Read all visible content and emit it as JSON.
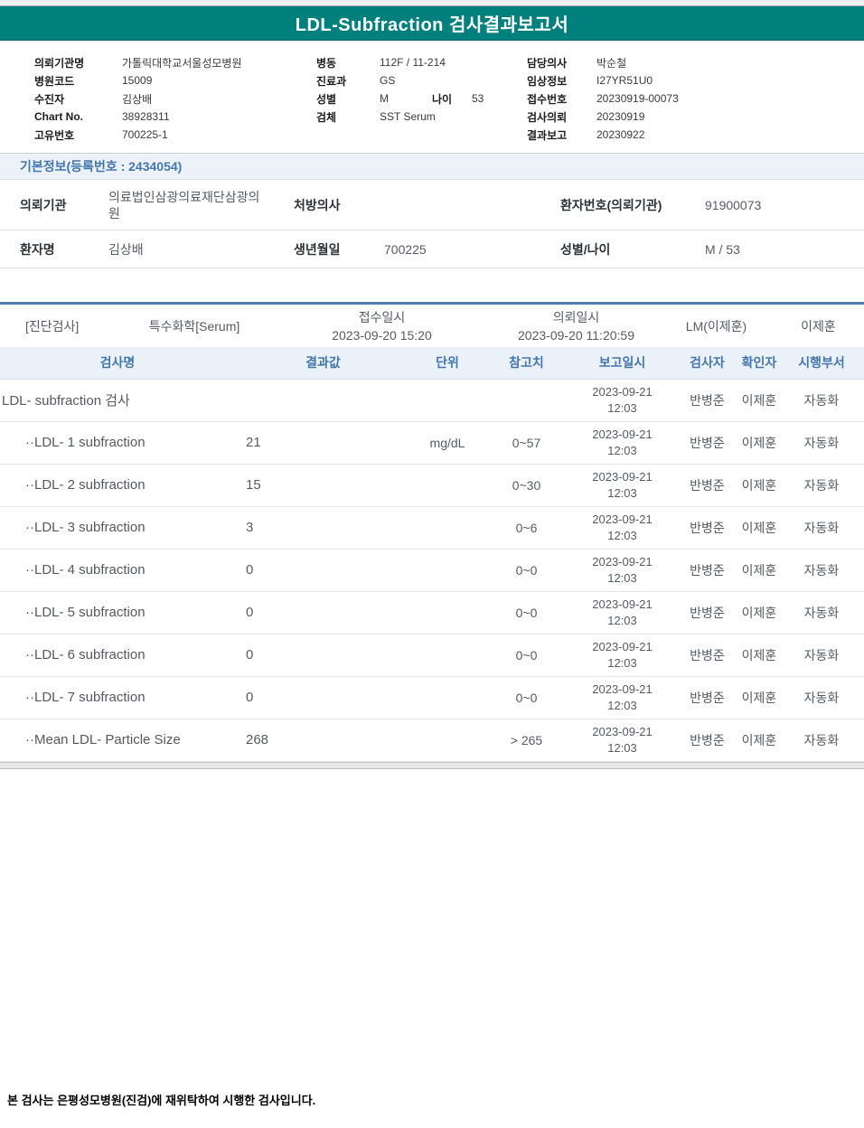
{
  "title": "LDL-Subfraction 검사결과보고서",
  "header_info": {
    "left": [
      {
        "label": "의뢰기관명",
        "value": "가톨릭대학교서울성모병원"
      },
      {
        "label": "병원코드",
        "value": "15009"
      },
      {
        "label": "수진자",
        "value": "김상배"
      },
      {
        "label": "Chart No.",
        "value": "38928311"
      },
      {
        "label": "고유번호",
        "value": "700225-1"
      }
    ],
    "middle": [
      {
        "label": "병동",
        "value": "112F / 11-214"
      },
      {
        "label": "진료과",
        "value": "GS"
      },
      {
        "label": "성별",
        "value": "M",
        "label2": "나이",
        "value2": "53"
      },
      {
        "label": "검체",
        "value": "SST Serum"
      }
    ],
    "right": [
      {
        "label": "담당의사",
        "value": "박순철"
      },
      {
        "label": "임상정보",
        "value": "I27YR51U0"
      },
      {
        "label": "접수번호",
        "value": "20230919-00073"
      },
      {
        "label": "검사의뢰",
        "value": "20230919"
      },
      {
        "label": "결과보고",
        "value": "20230922"
      }
    ]
  },
  "basic_info": {
    "section_title": "기본정보(등록번호 : 2434054)",
    "row1": {
      "label1": "의뢰기관",
      "value1": "의료법인삼광의료재단삼광의원",
      "label2": "처방의사",
      "value2": "",
      "label3": "환자번호(의뢰기관)",
      "value3": "91900073"
    },
    "row2": {
      "label1": "환자명",
      "value1": "김상배",
      "label2": "생년월일",
      "value2": "700225",
      "label3": "성별/나이",
      "value3": "M / 53"
    }
  },
  "section_row": {
    "dept": "[진단검사]",
    "category": "특수화학[Serum]",
    "receipt_label": "접수일시",
    "receipt_value": "2023-09-20 15:20",
    "request_label": "의뢰일시",
    "request_value": "2023-09-20 11:20:59",
    "lm": "LM(이제훈)",
    "confirmer": "이제훈"
  },
  "results": {
    "headers": {
      "name": "검사명",
      "result": "결과값",
      "unit": "단위",
      "ref": "참고치",
      "report_datetime": "보고일시",
      "tester": "검사자",
      "confirmer": "확인자",
      "dept": "시행부서"
    },
    "rows": [
      {
        "name": "LDL- subfraction 검사",
        "result": "",
        "unit": "",
        "ref": "",
        "date": "2023-09-21",
        "time": "12:03",
        "tester": "반병준",
        "confirmer": "이제훈",
        "dept": "자동화"
      },
      {
        "name": "··LDL- 1 subfraction",
        "result": "21",
        "unit": "mg/dL",
        "ref": "0~57",
        "date": "2023-09-21",
        "time": "12:03",
        "tester": "반병준",
        "confirmer": "이제훈",
        "dept": "자동화"
      },
      {
        "name": "··LDL- 2 subfraction",
        "result": "15",
        "unit": "",
        "ref": "0~30",
        "date": "2023-09-21",
        "time": "12:03",
        "tester": "반병준",
        "confirmer": "이제훈",
        "dept": "자동화"
      },
      {
        "name": "··LDL- 3 subfraction",
        "result": "3",
        "unit": "",
        "ref": "0~6",
        "date": "2023-09-21",
        "time": "12:03",
        "tester": "반병준",
        "confirmer": "이제훈",
        "dept": "자동화"
      },
      {
        "name": "··LDL- 4 subfraction",
        "result": "0",
        "unit": "",
        "ref": "0~0",
        "date": "2023-09-21",
        "time": "12:03",
        "tester": "반병준",
        "confirmer": "이제훈",
        "dept": "자동화"
      },
      {
        "name": "··LDL- 5 subfraction",
        "result": "0",
        "unit": "",
        "ref": "0~0",
        "date": "2023-09-21",
        "time": "12:03",
        "tester": "반병준",
        "confirmer": "이제훈",
        "dept": "자동화"
      },
      {
        "name": "··LDL- 6 subfraction",
        "result": "0",
        "unit": "",
        "ref": "0~0",
        "date": "2023-09-21",
        "time": "12:03",
        "tester": "반병준",
        "confirmer": "이제훈",
        "dept": "자동화"
      },
      {
        "name": "··LDL- 7 subfraction",
        "result": "0",
        "unit": "",
        "ref": "0~0",
        "date": "2023-09-21",
        "time": "12:03",
        "tester": "반병준",
        "confirmer": "이제훈",
        "dept": "자동화"
      },
      {
        "name": "··Mean LDL- Particle Size",
        "result": "268",
        "unit": "",
        "ref": "> 265",
        "date": "2023-09-21",
        "time": "12:03",
        "tester": "반병준",
        "confirmer": "이제훈",
        "dept": "자동화"
      }
    ]
  },
  "footer_note": "본 검사는 은평성모병원(진검)에 재위탁하여 시행한 검사입니다.",
  "colors": {
    "teal_header": "#00807c",
    "accent_blue": "#4377ae",
    "divider_blue": "#4c7ca8",
    "header_row_bg": "#ebf1f8",
    "section_bar_bg": "#edf2f8"
  }
}
